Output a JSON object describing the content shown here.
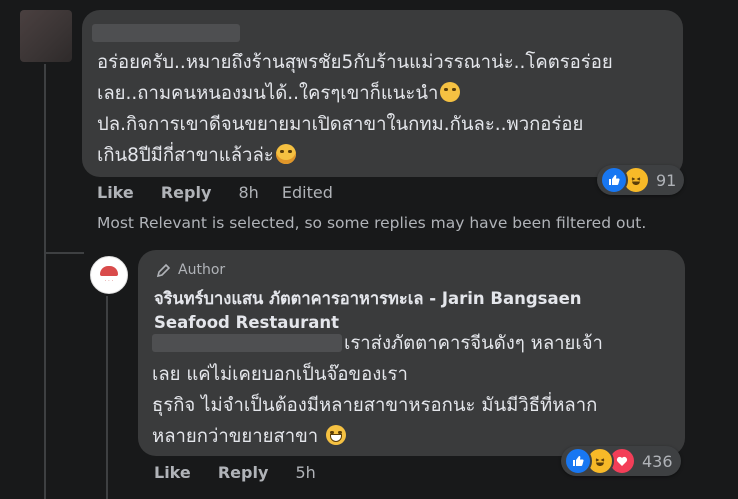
{
  "comment": {
    "lines": [
      "อร่อยครับ..หมายถึงร้านสุพรชัย5กับร้านแม่วรรณาน่ะ..โคตรอร่อย",
      "เลย..ถามคนหนองมนได้..ใครๆเขาก็แนะนำ",
      "ปล.กิจการเขาดีจนขยายมาเปิดสาขาในกทม.กันละ..พวกอร่อย",
      "เกิน8ปีมีกี่สาขาแล้วล่ะ"
    ],
    "actions": {
      "like": "Like",
      "reply": "Reply",
      "time": "8h",
      "edited": "Edited"
    },
    "reaction_count": "91"
  },
  "filter_notice": "Most Relevant is selected, so some replies may have been filtered out.",
  "reply": {
    "badge": "Author",
    "page_name": "จรินทร์บางแสน ภัตตาคารอาหารทะเล - Jarin Bangsaen Seafood Restaurant",
    "lines": [
      "เราส่งภัตตาคารจีนดังๆ หลายเจ้า",
      "เลย แค่ไม่เคยบอกเป็นจ๊อของเรา",
      "ธุรกิจ ไม่จำเป็นต้องมีหลายสาขาหรอกนะ มันมีวิธีที่หลาก",
      "หลายกว่าขยายสาขา"
    ],
    "actions": {
      "like": "Like",
      "reply": "Reply",
      "time": "5h"
    },
    "reaction_count": "436"
  },
  "colors": {
    "background": "#18191a",
    "bubble": "#3a3b3c",
    "text": "#e4e6eb",
    "secondary": "#b0b3b8",
    "like_blue": "#1877f2",
    "love_red": "#f33e58",
    "haha_yellow": "#f7b928"
  }
}
